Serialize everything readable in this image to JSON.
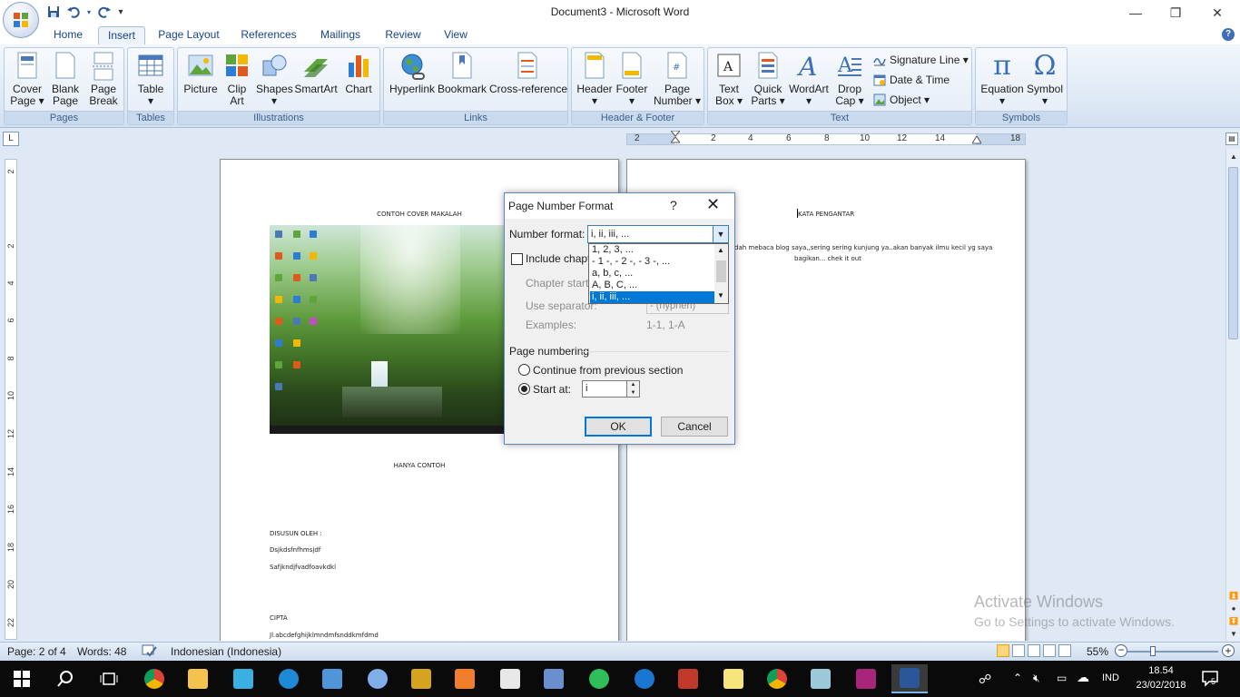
{
  "window": {
    "title": "Document3 - Microsoft Word",
    "minimize": "—",
    "restore": "❐",
    "close": "✕"
  },
  "qat": {
    "save": "save-icon",
    "undo": "undo-icon",
    "redo": "redo-icon",
    "customize": "▾"
  },
  "tabs": [
    {
      "label": "Home"
    },
    {
      "label": "Insert"
    },
    {
      "label": "Page Layout"
    },
    {
      "label": "References"
    },
    {
      "label": "Mailings"
    },
    {
      "label": "Review"
    },
    {
      "label": "View"
    }
  ],
  "ribbon": {
    "pages": {
      "label": "Pages",
      "cover": [
        "Cover",
        "Page ▾"
      ],
      "blank": [
        "Blank",
        "Page"
      ],
      "break": [
        "Page",
        "Break"
      ]
    },
    "tables": {
      "label": "Tables",
      "table": [
        "Table",
        "▾"
      ]
    },
    "illustrations": {
      "label": "Illustrations",
      "picture": "Picture",
      "clipart": [
        "Clip",
        "Art"
      ],
      "shapes": [
        "Shapes",
        "▾"
      ],
      "smartart": "SmartArt",
      "chart": "Chart"
    },
    "links": {
      "label": "Links",
      "hyperlink": "Hyperlink",
      "bookmark": "Bookmark",
      "crossref": "Cross-reference"
    },
    "headerfooter": {
      "label": "Header & Footer",
      "header": [
        "Header",
        "▾"
      ],
      "footer": [
        "Footer",
        "▾"
      ],
      "pagenumber": [
        "Page",
        "Number ▾"
      ]
    },
    "text": {
      "label": "Text",
      "textbox": [
        "Text",
        "Box ▾"
      ],
      "quickparts": [
        "Quick",
        "Parts ▾"
      ],
      "wordart": [
        "WordArt",
        "▾"
      ],
      "dropcap": [
        "Drop",
        "Cap ▾"
      ],
      "signature": "Signature Line ▾",
      "datetime": "Date & Time",
      "object": "Object ▾"
    },
    "symbols": {
      "label": "Symbols",
      "equation": [
        "Equation",
        "▾"
      ],
      "symbol": [
        "Symbol",
        "▾"
      ]
    }
  },
  "ruler": {
    "corner": "L",
    "h_numbers": [
      "2",
      "2",
      "4",
      "6",
      "8",
      "10",
      "12",
      "14",
      "18"
    ],
    "v_numbers": [
      "2",
      "2",
      "4",
      "6",
      "8",
      "10",
      "12",
      "14",
      "16",
      "18",
      "20",
      "22"
    ]
  },
  "page1": {
    "title": "CONTOH COVER MAKALAH",
    "subtitle": "HANYA CONTOH",
    "author_label": "DISUSUN OLEH :",
    "name1": "Dsjkdsfnfhmsjdf",
    "name2": "Safjkndjfvadfoavkdkl",
    "city": "CIPTA",
    "address": "Jl.abcdefghijklmndmfsnddkmfdmd"
  },
  "page2": {
    "title": "KATA PENGANTAR",
    "line1": "dah mebaca blog saya,,sering sering kunjung ya..akan banyak ilmu kecil yg saya",
    "line2": "bagikan... chek it out"
  },
  "dialog": {
    "title": "Page Number Format",
    "help": "?",
    "close": "✕",
    "number_format_label": "Number format:",
    "number_format_value": "i, ii, iii, ...",
    "options": [
      "1, 2, 3, ...",
      "- 1 -, - 2 -, - 3 -, ...",
      "a, b, c, ...",
      "A, B, C, ...",
      "i, ii, iii, ..."
    ],
    "selected_index": 4,
    "include_chapter": "Include chapte",
    "chapter_starts": "Chapter starts",
    "use_separator": "Use separator:",
    "separator_value": "-  (hyphen)",
    "examples_label": "Examples:",
    "examples_value": "1-1, 1-A",
    "page_numbering": "Page numbering",
    "continue": "Continue from previous section",
    "start_at": "Start at:",
    "start_value": "i",
    "ok": "OK",
    "cancel": "Cancel"
  },
  "watermark": {
    "line1": "Activate Windows",
    "line2": "Go to Settings to activate Windows."
  },
  "status": {
    "page": "Page: 2 of 4",
    "words": "Words: 48",
    "language": "Indonesian (Indonesia)",
    "zoom": "55%"
  },
  "taskbar": {
    "lang": "IND",
    "time": "18.54",
    "date": "23/02/2018",
    "notif_count": "5"
  },
  "colors": {
    "accent": "#2b579a",
    "select": "#0078d7"
  }
}
